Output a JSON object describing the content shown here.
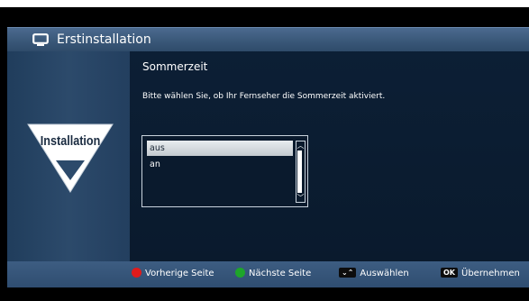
{
  "header": {
    "title": "Erstinstallation",
    "icon": "tv-icon"
  },
  "sidebar": {
    "logo_text": "Installation",
    "logo_icon": "installation-triangle-logo"
  },
  "main": {
    "section_title": "Sommerzeit",
    "description": "Bitte wählen Sie, ob Ihr Fernseher die Sommerzeit aktiviert.",
    "options": [
      {
        "label": "aus",
        "selected": true
      },
      {
        "label": "an",
        "selected": false
      }
    ]
  },
  "footer": {
    "hints": [
      {
        "key": "red-button",
        "color": "#e11b1b",
        "label": "Vorherige Seite"
      },
      {
        "key": "green-button",
        "color": "#1ea52a",
        "label": "Nächste Seite"
      },
      {
        "key": "up-down-arrows",
        "label": "Auswählen"
      },
      {
        "key": "OK",
        "label": "Übernehmen"
      }
    ]
  },
  "colors": {
    "titlebar": "#3a5879",
    "main_bg": "#0a1a2d",
    "sidebar_bg": "#2c4a6b",
    "footer_bg": "#355577"
  }
}
